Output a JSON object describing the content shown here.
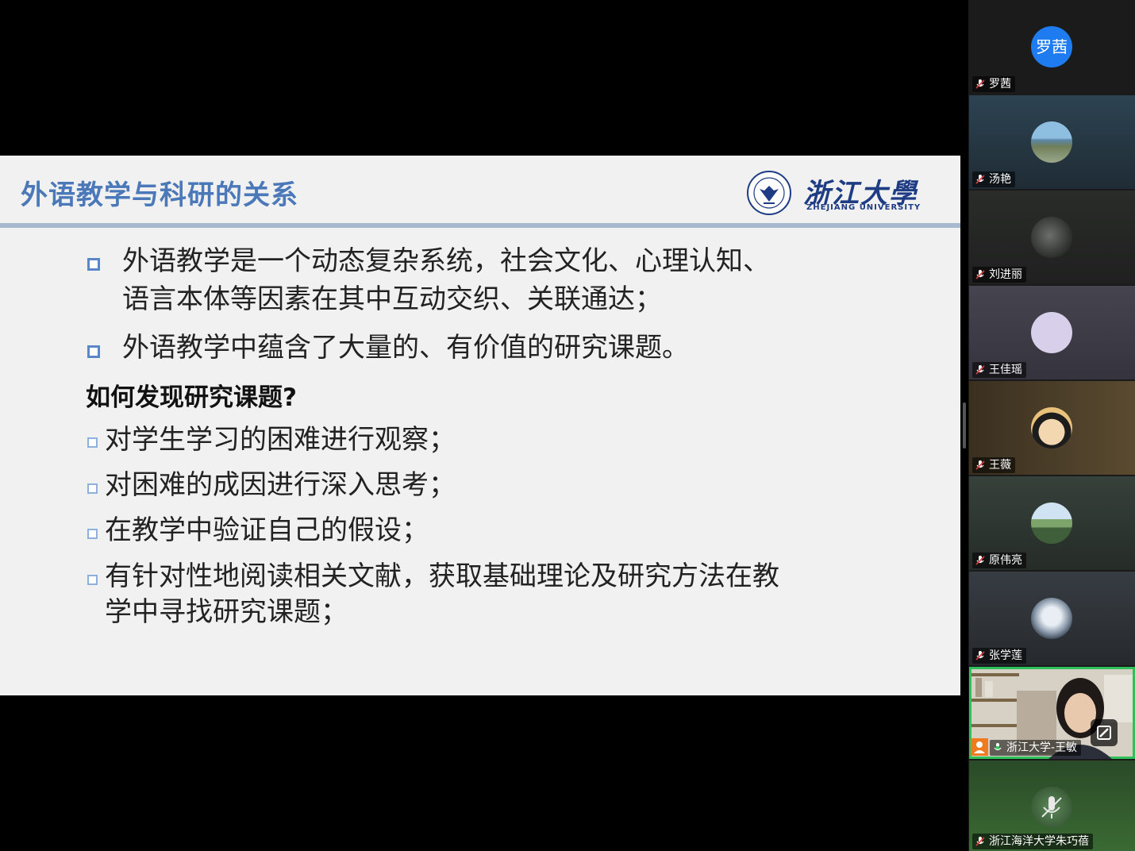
{
  "slide": {
    "title": "外语教学与科研的关系",
    "logo_text": "浙江大學",
    "logo_subtitle": "ZHEJIANG UNIVERSITY",
    "bullets": [
      {
        "line1": "外语教学是一个动态复杂系统，社会文化、心理认知、",
        "line2": "语言本体等因素在其中互动交织、关联通达；"
      },
      {
        "line1": "外语教学中蕴含了大量的、有价值的研究课题。"
      }
    ],
    "subheading": "如何发现研究课题?",
    "sub_bullets": [
      {
        "line1": "对学生学习的困难进行观察；"
      },
      {
        "line1": "对困难的成因进行深入思考；"
      },
      {
        "line1": "在教学中验证自己的假设；"
      },
      {
        "line1": "有针对性地阅读相关文献，获取基础理论及研究方法在教",
        "line2": "学中寻找研究课题；"
      }
    ]
  },
  "participants": [
    {
      "name": "罗茜",
      "avatar_text": "罗茜",
      "avatar_color": "#1e7bf0",
      "tile_bg": "#1b1b1b",
      "muted": true
    },
    {
      "name": "汤艳",
      "tile_bg": "#263540",
      "muted": true,
      "avatar_icon": "landscape-icon"
    },
    {
      "name": "刘进丽",
      "tile_bg": "#252725",
      "muted": true,
      "avatar_icon": "fish-icon"
    },
    {
      "name": "王佳瑶",
      "tile_bg": "#3e3d4a",
      "muted": true,
      "avatar_icon": "blank-avatar-icon"
    },
    {
      "name": "王薇",
      "tile_bg": "#4a3a25",
      "muted": true,
      "avatar_icon": "cartoon-avatar-icon"
    },
    {
      "name": "原伟亮",
      "tile_bg": "#2f3832",
      "muted": true,
      "avatar_icon": "building-avatar-icon"
    },
    {
      "name": "张学莲",
      "tile_bg": "#2e3338",
      "muted": true,
      "avatar_icon": "moon-avatar-icon"
    },
    {
      "name": "浙江大学-王敏",
      "tile_bg": "#c9c3b8",
      "muted": false,
      "active_speaker": true,
      "video": true
    },
    {
      "name": "浙江海洋大学朱巧蓓",
      "tile_bg": "#2f5a2a",
      "muted": true,
      "avatar_icon": "microphone-avatar-icon"
    }
  ]
}
